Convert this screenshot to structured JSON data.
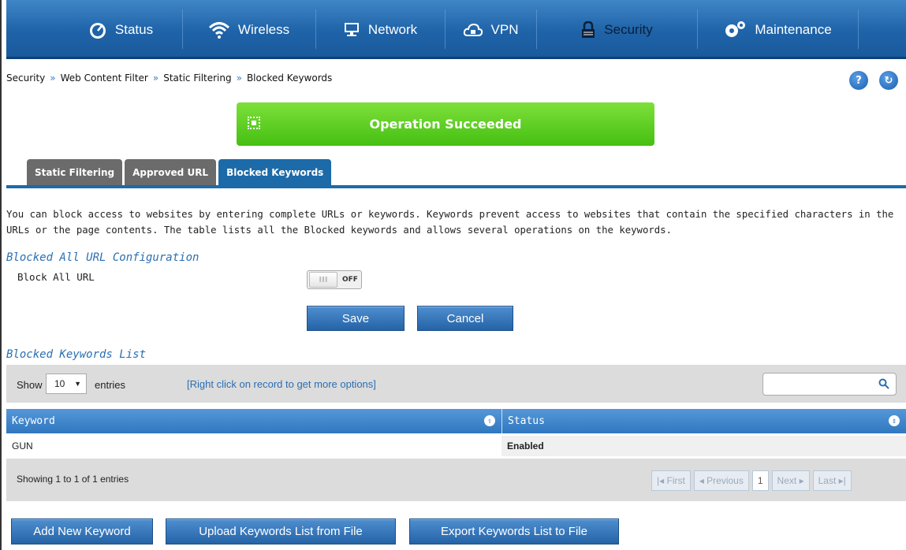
{
  "nav": {
    "items": [
      {
        "label": "Status",
        "icon": "gauge-icon"
      },
      {
        "label": "Wireless",
        "icon": "wifi-icon"
      },
      {
        "label": "Network",
        "icon": "monitor-icon"
      },
      {
        "label": "VPN",
        "icon": "cloud-lock-icon"
      },
      {
        "label": "Security",
        "icon": "lock-icon"
      },
      {
        "label": "Maintenance",
        "icon": "gears-icon"
      }
    ],
    "active": "Security"
  },
  "breadcrumb": [
    "Security",
    "Web Content Filter",
    "Static Filtering",
    "Blocked Keywords"
  ],
  "breadcrumb_sep": "»",
  "help_label": "?",
  "refresh_label": "↻",
  "banner": {
    "text": "Operation Succeeded",
    "color": "#5ccf22"
  },
  "tabs": [
    {
      "label": "Static Filtering",
      "active": false
    },
    {
      "label": "Approved URL",
      "active": false
    },
    {
      "label": "Blocked Keywords",
      "active": true
    }
  ],
  "description": "You can block access to websites by entering complete URLs or keywords. Keywords prevent access to websites that contain the specified characters in the URLs or the page contents. The table lists all the Blocked keywords and allows several operations on the keywords.",
  "config": {
    "title": "Blocked All URL Configuration",
    "block_all_label": "Block All URL",
    "toggle_knob": "III",
    "toggle_state": "OFF",
    "save_label": "Save",
    "cancel_label": "Cancel"
  },
  "list": {
    "title": "Blocked Keywords List",
    "show_label": "Show",
    "page_size": "10",
    "entries_label": "entries",
    "hint": "[Right click on record to get more options]",
    "search_placeholder": "",
    "columns": [
      "Keyword",
      "Status"
    ],
    "rows": [
      {
        "keyword": "GUN",
        "status": "Enabled"
      }
    ],
    "showing": "Showing 1 to 1 of 1 entries",
    "pager": {
      "first": "First",
      "previous": "Previous",
      "current": "1",
      "next": "Next",
      "last": "Last"
    }
  },
  "actions": {
    "add": "Add New Keyword",
    "upload": "Upload Keywords List from File",
    "export": "Export Keywords List to File"
  },
  "colors": {
    "accent": "#1d6aa8",
    "nav": "#2a6fb5",
    "link": "#2a6fb2",
    "success": "#5ccf22"
  }
}
